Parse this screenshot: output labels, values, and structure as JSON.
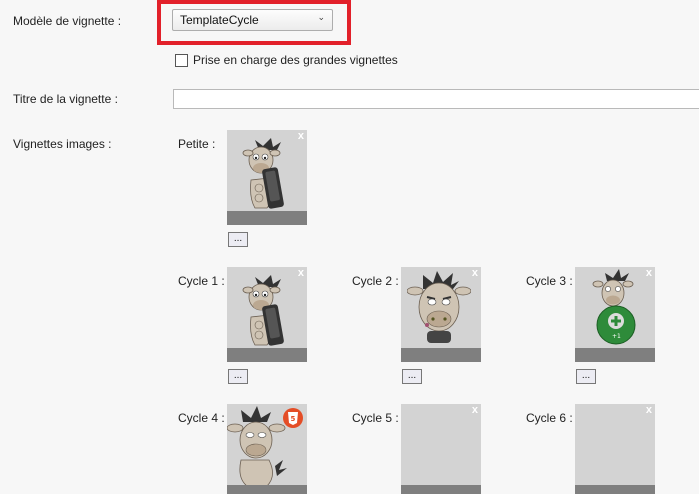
{
  "form": {
    "template_label": "Modèle de vignette :",
    "template_value": "TemplateCycle",
    "large_checkbox_label": "Prise en charge des grandes vignettes",
    "large_checkbox_checked": false,
    "title_label": "Titre de la vignette :",
    "title_value": "",
    "images_label": "Vignettes images :"
  },
  "thumbnails": {
    "close_glyph": "x",
    "browse_label": "...",
    "items": [
      {
        "label": "Petite :",
        "icon": "donkey-phone-icon"
      },
      {
        "label": "Cycle 1 :",
        "icon": "donkey-phone-icon"
      },
      {
        "label": "Cycle 2 :",
        "icon": "donkey-face-icon"
      },
      {
        "label": "Cycle 3 :",
        "icon": "donkey-plus-one-icon"
      },
      {
        "label": "Cycle 4 :",
        "icon": "donkey-html5-icon"
      },
      {
        "label": "Cycle 5 :",
        "icon": "empty-thumbnail"
      },
      {
        "label": "Cycle 6 :",
        "icon": "empty-thumbnail"
      }
    ]
  },
  "colors": {
    "highlight": "#e2202a",
    "thumb_bg": "#d3d3d3",
    "thumb_bar": "#7f7f7f"
  }
}
